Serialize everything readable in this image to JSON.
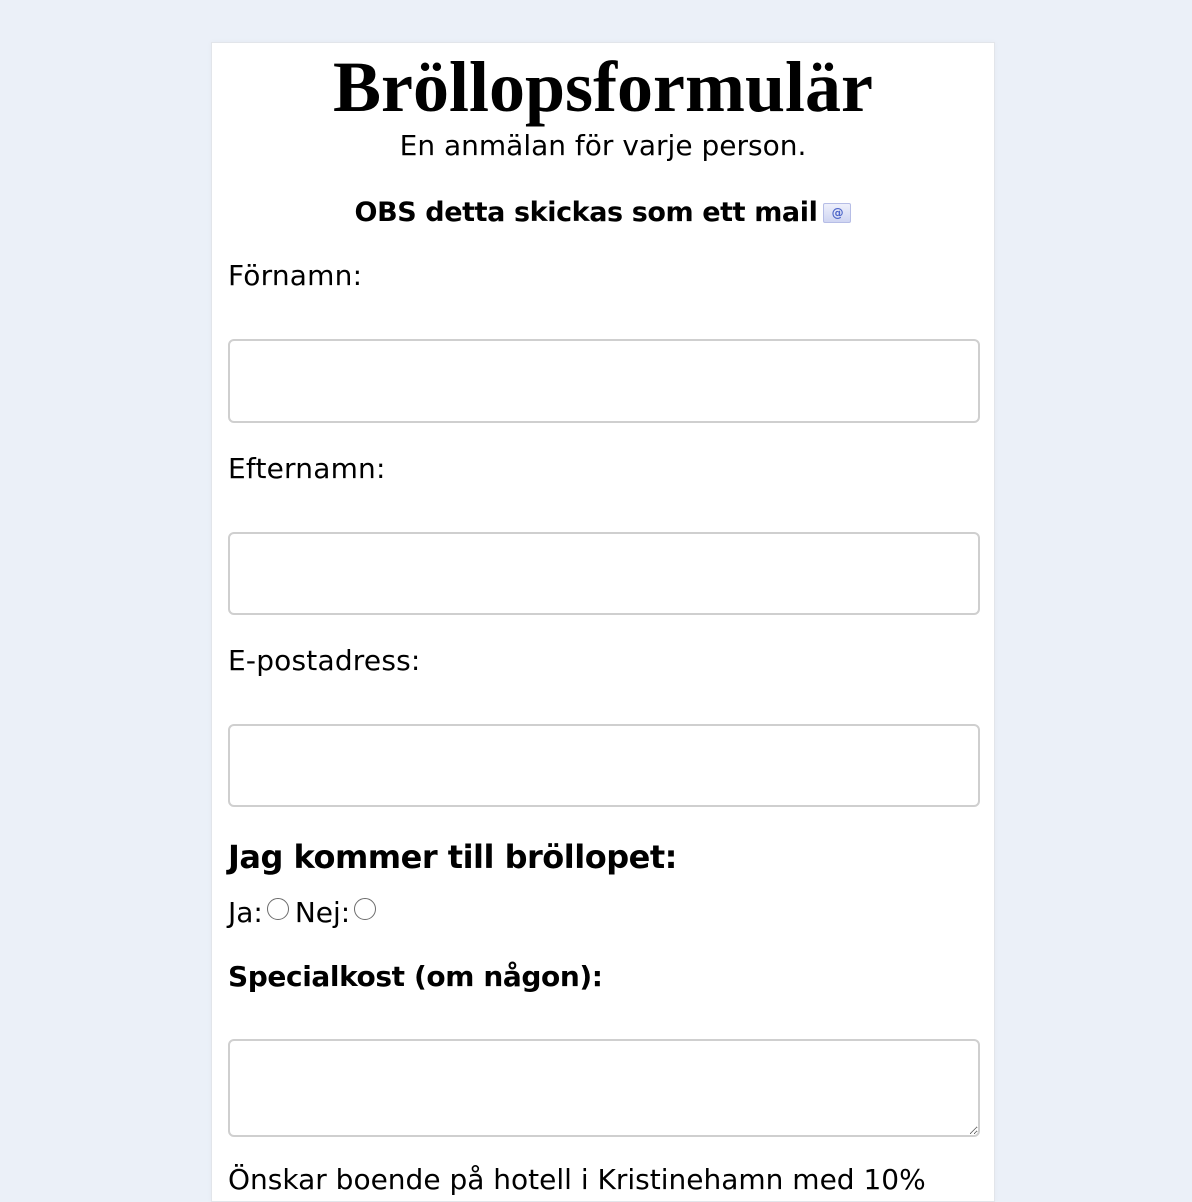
{
  "form": {
    "title": "Bröllopsformulär",
    "subtitle": "En anmälan för varje person.",
    "notice": "OBS detta skickas som ett mail",
    "notice_icon": "email-icon",
    "first_name_label": "Förnamn:",
    "first_name_value": "",
    "last_name_label": "Efternamn:",
    "last_name_value": "",
    "email_label": "E-postadress:",
    "email_value": "",
    "attending_heading": "Jag kommer till bröllopet:",
    "attending_yes_label": "Ja:",
    "attending_no_label": "Nej:",
    "diet_heading": "Specialkost (om någon):",
    "diet_value": "",
    "hotel_text": "Önskar boende på hotell i Kristinehamn med 10%"
  },
  "colors": {
    "page_background": "#ebf0f8",
    "card_background": "#ffffff",
    "input_border": "#cfcfcf"
  }
}
